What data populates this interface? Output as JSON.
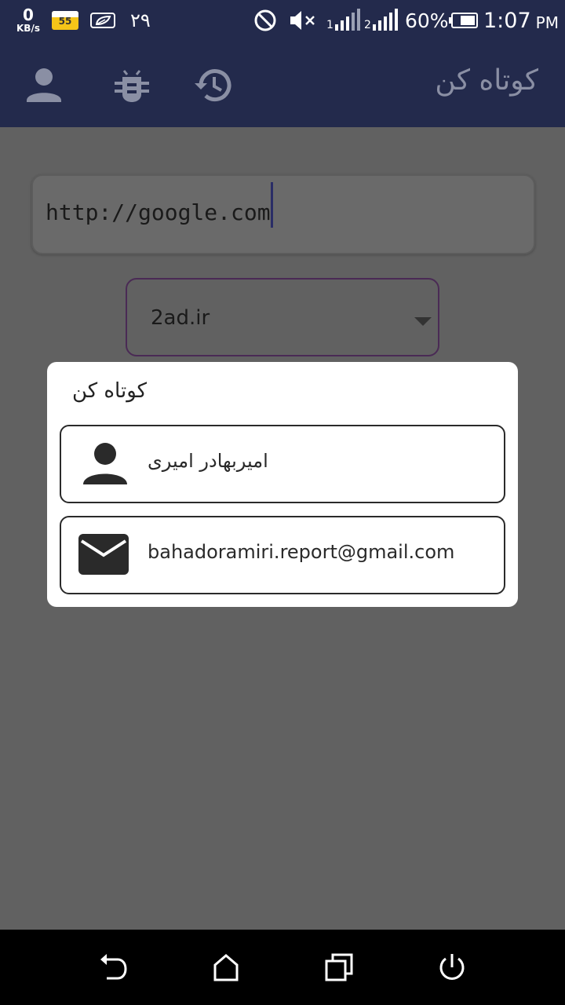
{
  "status_bar": {
    "net_speed_value": "0",
    "net_speed_unit": "KB/s",
    "notification_badge": "55",
    "date_day": "۲۹",
    "sim1_label": "1",
    "sim2_label": "2",
    "battery_percent": "60%",
    "time": "1:07",
    "ampm": "PM"
  },
  "app_bar": {
    "title": "کوتاه کن",
    "icons": [
      "person-icon",
      "bug-icon",
      "history-icon"
    ]
  },
  "form": {
    "url_value": "http://google.com",
    "domain_selected": "2ad.ir"
  },
  "dialog": {
    "title": "کوتاه کن",
    "author_name": "امیربهادر امیری",
    "author_email": "bahadoramiri.report@gmail.com"
  },
  "nav_bar": {
    "icons": [
      "back-icon",
      "home-icon",
      "recents-icon",
      "power-icon"
    ]
  },
  "colors": {
    "primary": "#232a4c",
    "scrim": "#616161",
    "select_border": "#4a2a55",
    "cursor": "#2a2d66"
  }
}
